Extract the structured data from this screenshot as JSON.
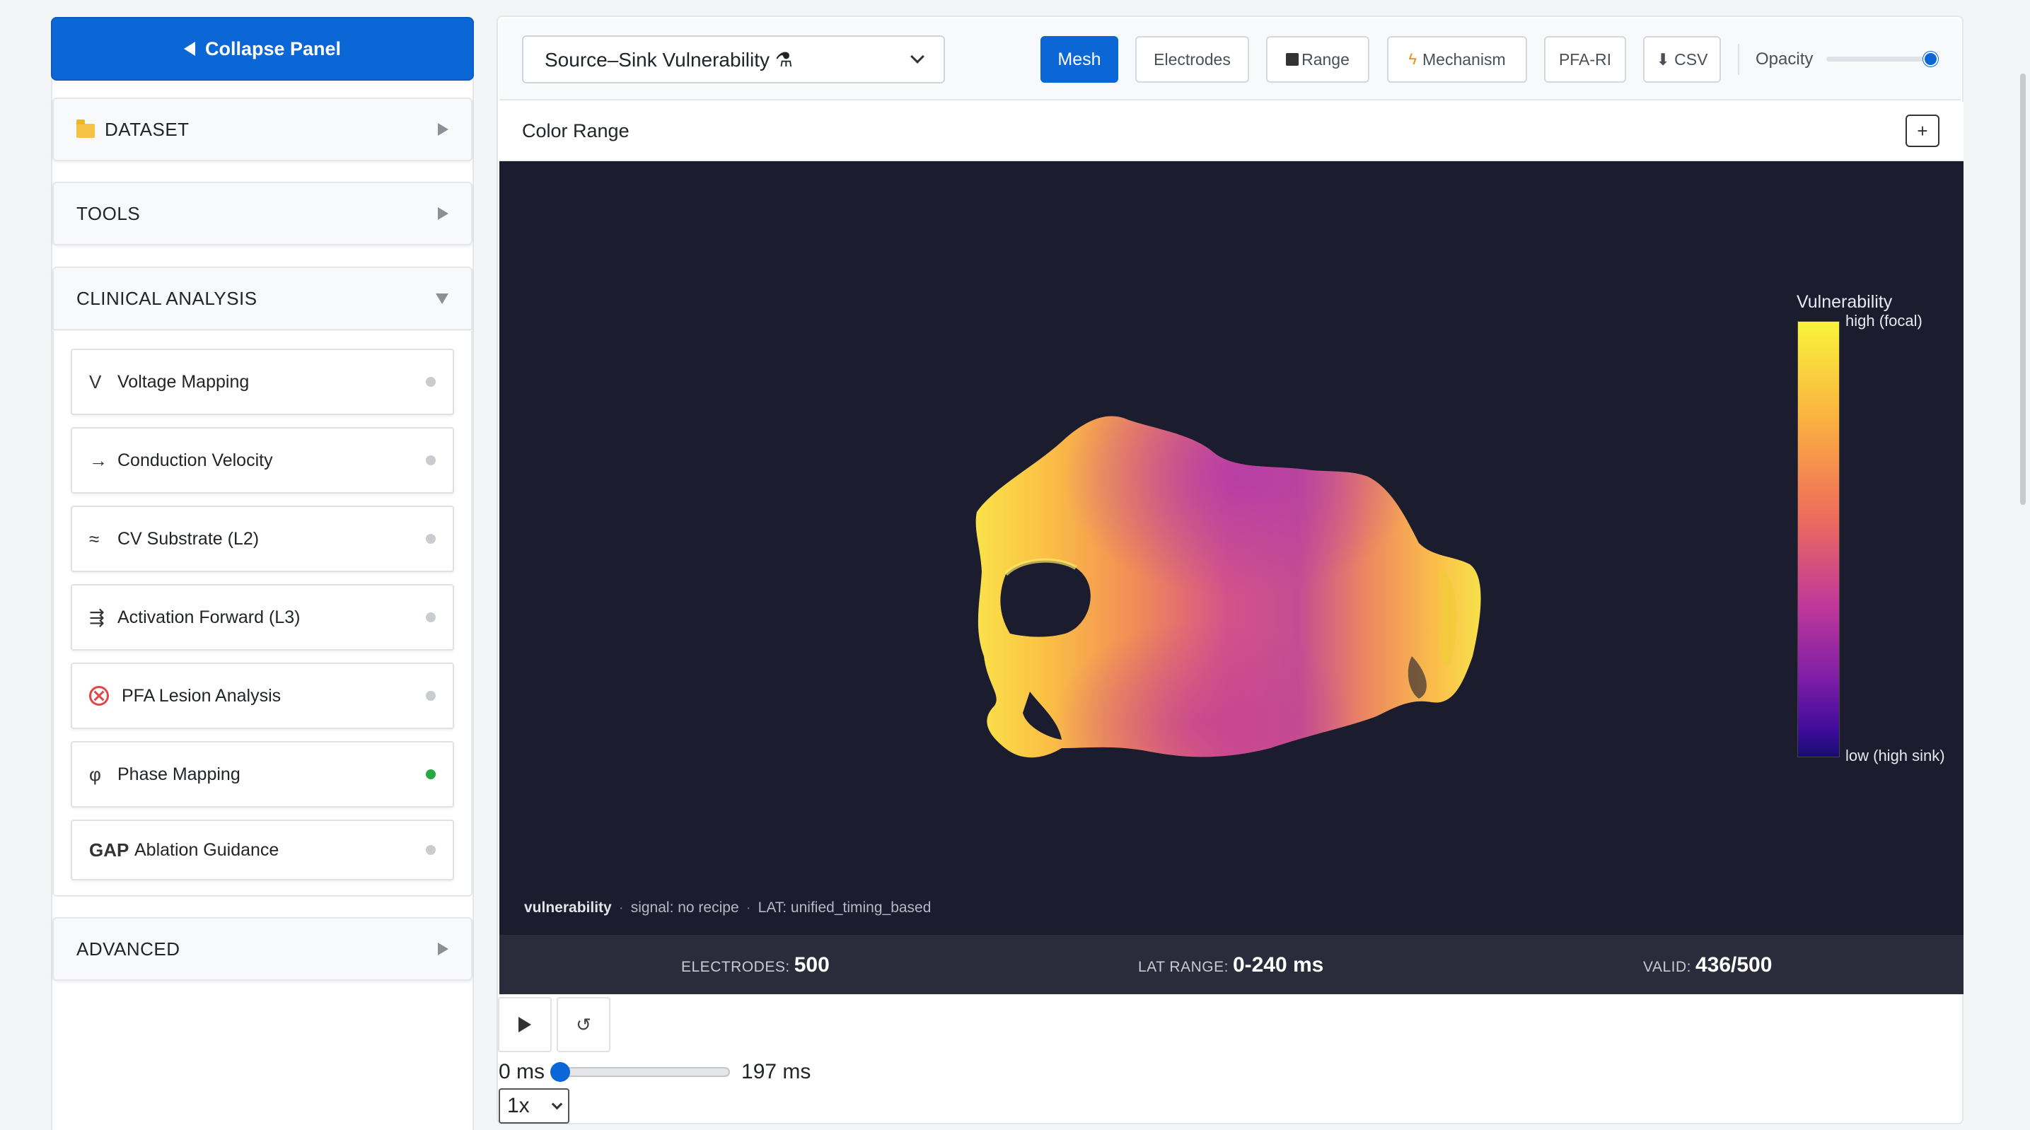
{
  "sidebar": {
    "collapse_label": "Collapse Panel",
    "sections": {
      "dataset": "DATASET",
      "tools": "TOOLS",
      "clinical": "CLINICAL ANALYSIS",
      "advanced": "ADVANCED"
    },
    "clinical_items": [
      {
        "icon": "V",
        "label": "Voltage Mapping",
        "active": false
      },
      {
        "icon": "→",
        "label": "Conduction Velocity",
        "active": false
      },
      {
        "icon": "≈",
        "label": "CV Substrate (L2)",
        "active": false
      },
      {
        "icon": "⇶",
        "label": "Activation Forward (L3)",
        "active": false
      },
      {
        "icon": "forbid-icon",
        "label": "PFA Lesion Analysis",
        "active": false
      },
      {
        "icon": "φ",
        "label": "Phase Mapping",
        "active": true
      },
      {
        "icon": "GAP",
        "label": "Ablation Guidance",
        "active": false
      }
    ]
  },
  "toolbar": {
    "mode_select": "Source–Sink Vulnerability ⚗",
    "buttons": {
      "mesh": "Mesh",
      "electrodes": "Electrodes",
      "range": "Range",
      "mechanism": "Mechanism",
      "pfa_ri": "PFA-RI",
      "csv": "⬇ CSV"
    },
    "opacity_label": "Opacity",
    "opacity_value": 1.0
  },
  "color_range": {
    "title": "Color Range",
    "toggle": "+"
  },
  "viewer": {
    "colorbar_title": "Vulnerability",
    "colorbar_high": "high (focal)",
    "colorbar_low": "low (high sink)",
    "info_metric": "vulnerability",
    "info_signal": "signal: no recipe",
    "info_lat": "LAT: unified_timing_based"
  },
  "stats": {
    "electrodes_label": "ELECTRODES:",
    "electrodes_value": "500",
    "lat_label": "LAT RANGE:",
    "lat_value": "0-240 ms",
    "valid_label": "VALID:",
    "valid_value": "436/500"
  },
  "playback": {
    "play_icon": "play-icon",
    "reset_icon": "↺",
    "time_start": "0 ms",
    "time_end": "197 ms",
    "time_position": 0,
    "speed": "1x"
  },
  "colors": {
    "accent": "#0b66d6",
    "viewer_bg": "#1b1c2e",
    "stats_bg": "#2a2b3b",
    "active_dot": "#28a745"
  }
}
